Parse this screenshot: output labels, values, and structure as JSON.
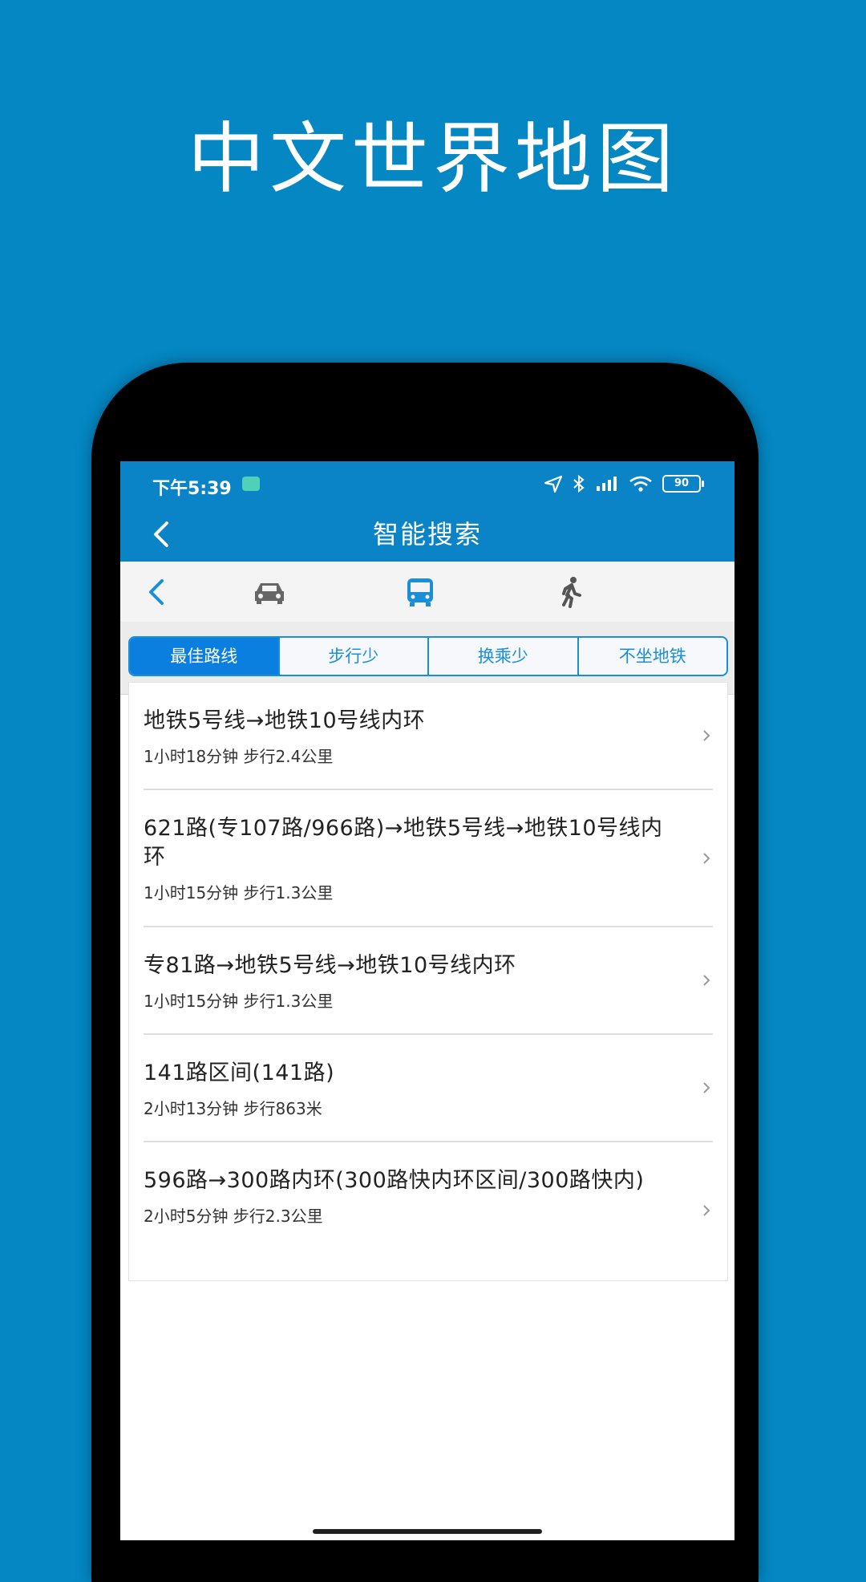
{
  "promo": {
    "title": "中文世界地图"
  },
  "status": {
    "time": "下午5:39",
    "battery": "90"
  },
  "header": {
    "title": "智能搜索"
  },
  "modes": {
    "back": "back-arrow-icon",
    "items": [
      "car-icon",
      "bus-icon",
      "walk-icon"
    ],
    "selected": "bus-icon"
  },
  "filters": {
    "tabs": [
      "最佳路线",
      "步行少",
      "换乘少",
      "不坐地铁"
    ],
    "selected": "最佳路线"
  },
  "routes": [
    {
      "title": "地铁5号线→地铁10号线内环",
      "meta": "1小时18分钟  步行2.4公里"
    },
    {
      "title": "621路(专107路/966路)→地铁5号线→地铁10号线内环",
      "meta": "1小时15分钟  步行1.3公里"
    },
    {
      "title": "专81路→地铁5号线→地铁10号线内环",
      "meta": "1小时15分钟  步行1.3公里"
    },
    {
      "title": "141路区间(141路)",
      "meta": "2小时13分钟  步行863米"
    },
    {
      "title": "596路→300路内环(300路快内环区间/300路快内)",
      "meta": "2小时5分钟  步行2.3公里"
    }
  ],
  "colors": {
    "background": "#0487c3",
    "header": "#0a84c6",
    "accent": "#0a7fe0"
  }
}
